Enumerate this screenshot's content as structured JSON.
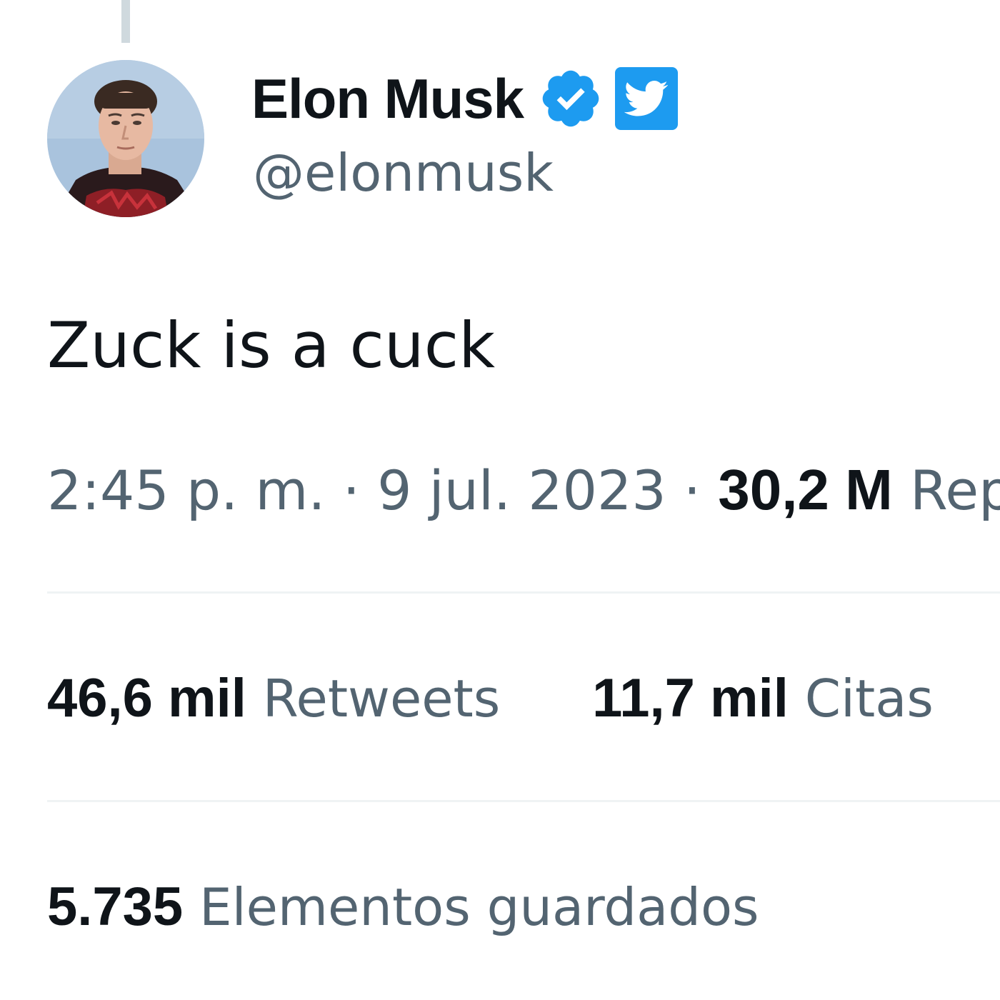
{
  "author": {
    "display_name": "Elon Musk",
    "handle": "@elonmusk",
    "avatar_icon": "profile-photo",
    "verified_icon": "verified-badge-icon",
    "affiliate_icon": "twitter-bird-icon"
  },
  "tweet": {
    "text": "Zuck is a cuck",
    "time": "2:45 p. m.",
    "date": "9 jul. 2023",
    "views_count": "30,2 M",
    "views_label": "Repr"
  },
  "stats": {
    "retweets_count": "46,6 mil",
    "retweets_label": "Retweets",
    "quotes_count": "11,7 mil",
    "quotes_label": "Citas",
    "bookmarks_count": "5.735",
    "bookmarks_label": "Elementos guardados"
  },
  "colors": {
    "accent": "#1d9bf0",
    "text_primary": "#0f1419",
    "text_secondary": "#536471",
    "divider": "#eff3f4"
  }
}
